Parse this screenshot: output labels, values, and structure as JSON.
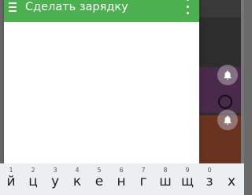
{
  "dialog": {
    "title": "Сделать зарядку"
  },
  "keyboard": {
    "keys": [
      {
        "char": "й",
        "hint": "1"
      },
      {
        "char": "ц",
        "hint": "2"
      },
      {
        "char": "у",
        "hint": "3"
      },
      {
        "char": "к",
        "hint": "4"
      },
      {
        "char": "е",
        "hint": "5"
      },
      {
        "char": "н",
        "hint": "6"
      },
      {
        "char": "г",
        "hint": "7"
      },
      {
        "char": "ш",
        "hint": "8"
      },
      {
        "char": "щ",
        "hint": "9"
      },
      {
        "char": "з",
        "hint": "0"
      },
      {
        "char": "х",
        "hint": ""
      }
    ]
  },
  "colors": {
    "header": "#4caf50",
    "keyboard_bg": "#eceff1"
  }
}
